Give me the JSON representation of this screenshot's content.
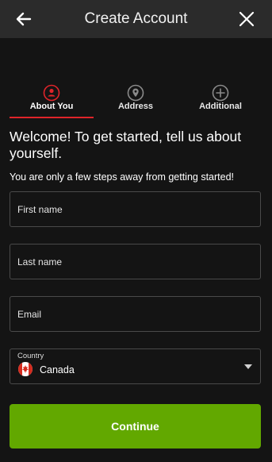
{
  "header": {
    "title": "Create Account",
    "back_icon": "arrow-left-icon",
    "close_icon": "close-icon"
  },
  "steps": [
    {
      "label": "About You",
      "icon": "user-circle-icon",
      "active": true
    },
    {
      "label": "Address",
      "icon": "location-pin-icon",
      "active": false
    },
    {
      "label": "Additional",
      "icon": "plus-circle-icon",
      "active": false
    }
  ],
  "intro": {
    "heading": "Welcome! To get started, tell us about yourself.",
    "subtext": "You are only a few steps away from getting started!"
  },
  "form": {
    "first_name": {
      "placeholder": "First name",
      "value": ""
    },
    "last_name": {
      "placeholder": "Last name",
      "value": ""
    },
    "email": {
      "placeholder": "Email",
      "value": ""
    },
    "country": {
      "label": "Country",
      "value": "Canada",
      "flag_icon": "canada-flag-icon"
    }
  },
  "continue_label": "Continue",
  "colors": {
    "accent_red": "#e0242a",
    "primary_green": "#62a800",
    "header_bg": "#2b2b2b",
    "page_bg": "#141414"
  }
}
